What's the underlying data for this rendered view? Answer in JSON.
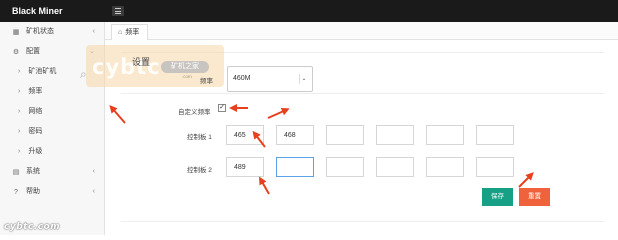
{
  "app": {
    "title": "Black Miner"
  },
  "sidebar": {
    "items": [
      {
        "label": "矿机状态",
        "icon": "grid-icon"
      },
      {
        "label": "配置",
        "icon": "gear-icon"
      },
      {
        "label": "矿池矿机"
      },
      {
        "label": "频率"
      },
      {
        "label": "网络"
      },
      {
        "label": "密码"
      },
      {
        "label": "升级"
      },
      {
        "label": "系统",
        "icon": "document-icon"
      },
      {
        "label": "帮助",
        "icon": "help-icon"
      }
    ]
  },
  "tabs": [
    {
      "label": "频率",
      "icon": "home-icon"
    }
  ],
  "form": {
    "title": "设置",
    "frequency_label": "频率",
    "frequency_value": "460M",
    "custom_label": "自定义频率",
    "custom_checked": true,
    "boards": [
      {
        "label": "控制板 1",
        "values": [
          "465",
          "468",
          "",
          "",
          "",
          ""
        ]
      },
      {
        "label": "控制板 2",
        "values": [
          "489",
          "",
          "",
          "",
          "",
          ""
        ]
      }
    ],
    "save_label": "保存",
    "reset_label": "重置"
  },
  "watermark": {
    "text": "cybtc",
    "tag": "矿机之家",
    "sub": ".com",
    "footer": "cybtc.com"
  },
  "colors": {
    "topbar": "#1a1a1a",
    "save": "#16a085",
    "reset": "#f0623c",
    "annotation_arrow": "#e8401c"
  }
}
